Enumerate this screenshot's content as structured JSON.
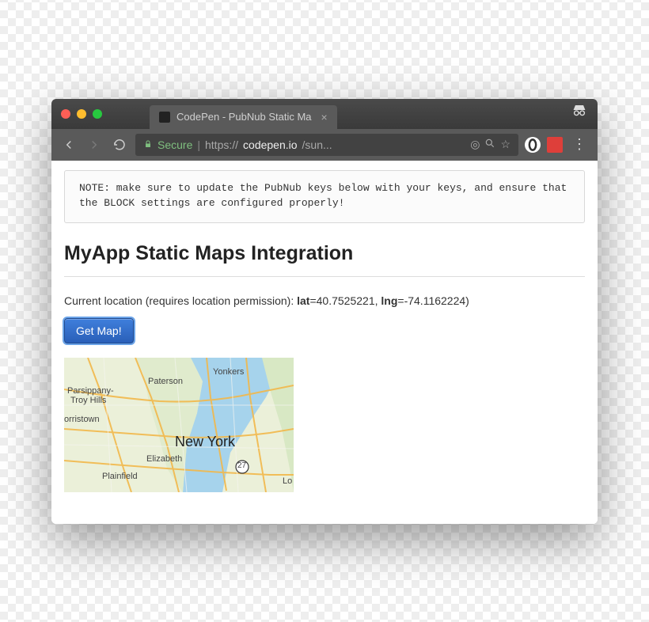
{
  "browser": {
    "tab_title": "CodePen - PubNub Static Ma",
    "secure_label": "Secure",
    "url_scheme": "https://",
    "url_host": "codepen.io",
    "url_path": "/sun..."
  },
  "note": {
    "text": "NOTE: make sure to update the PubNub keys below with your keys, and ensure that the BLOCK settings are configured properly!"
  },
  "page": {
    "title": "MyApp Static Maps Integration",
    "location_prefix": "Current location (requires location permission): ",
    "lat_label": "lat",
    "lat_value": "=40.7525221, ",
    "lng_label": "lng",
    "lng_value": "=-74.1162224)",
    "button_label": "Get Map!"
  },
  "map": {
    "labels": {
      "newyork": "New York",
      "yonkers": "Yonkers",
      "paterson": "Paterson",
      "elizabeth": "Elizabeth",
      "plainfield": "Plainfield",
      "parsippany": "Parsippany-",
      "troyhills": "Troy Hills",
      "orristown": "orristown",
      "route": "27",
      "lo": "Lo"
    }
  }
}
